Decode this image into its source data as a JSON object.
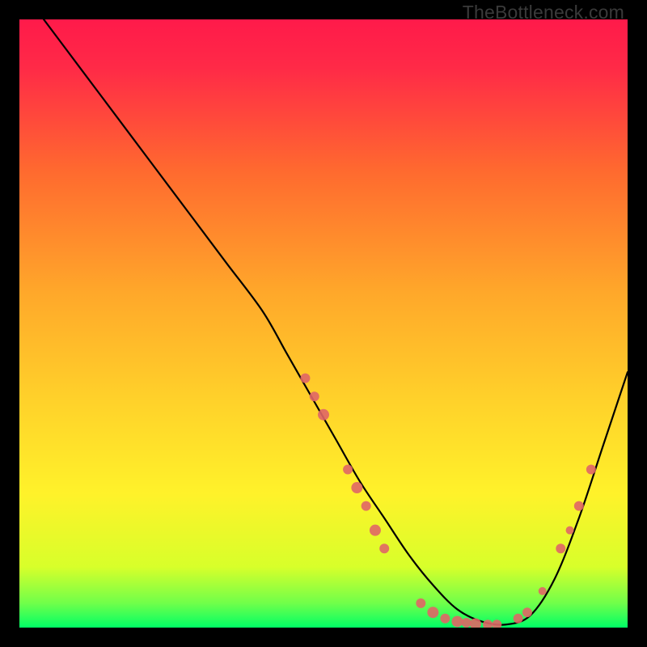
{
  "watermark": "TheBottleneck.com",
  "chart_data": {
    "type": "line",
    "title": "",
    "xlabel": "",
    "ylabel": "",
    "xlim": [
      0,
      100
    ],
    "ylim": [
      0,
      100
    ],
    "gradient_colors": {
      "top": "#ff1a4a",
      "upper_mid": "#ff6a2f",
      "mid": "#ffd02a",
      "lower_mid": "#fff22a",
      "bottom": "#00ff66"
    },
    "series": [
      {
        "name": "bottleneck-curve",
        "x": [
          4,
          10,
          16,
          22,
          28,
          34,
          40,
          44,
          48,
          52,
          56,
          60,
          64,
          68,
          72,
          76,
          80,
          84,
          88,
          92,
          96,
          100
        ],
        "y": [
          100,
          92,
          84,
          76,
          68,
          60,
          52,
          45,
          38,
          31,
          24,
          18,
          12,
          7,
          3,
          1,
          0.5,
          2,
          8,
          18,
          30,
          42
        ]
      }
    ],
    "markers": {
      "name": "highlight-points",
      "color": "#e06666",
      "points": [
        {
          "x": 47,
          "y": 41,
          "r": 6
        },
        {
          "x": 48.5,
          "y": 38,
          "r": 6
        },
        {
          "x": 50,
          "y": 35,
          "r": 7
        },
        {
          "x": 54,
          "y": 26,
          "r": 6
        },
        {
          "x": 55.5,
          "y": 23,
          "r": 7
        },
        {
          "x": 57,
          "y": 20,
          "r": 6
        },
        {
          "x": 58.5,
          "y": 16,
          "r": 7
        },
        {
          "x": 60,
          "y": 13,
          "r": 6
        },
        {
          "x": 66,
          "y": 4,
          "r": 6
        },
        {
          "x": 68,
          "y": 2.5,
          "r": 7
        },
        {
          "x": 70,
          "y": 1.5,
          "r": 6
        },
        {
          "x": 72,
          "y": 1,
          "r": 7
        },
        {
          "x": 73.5,
          "y": 0.8,
          "r": 6
        },
        {
          "x": 75,
          "y": 0.6,
          "r": 7
        },
        {
          "x": 77,
          "y": 0.5,
          "r": 6
        },
        {
          "x": 78.5,
          "y": 0.5,
          "r": 6
        },
        {
          "x": 82,
          "y": 1.5,
          "r": 6
        },
        {
          "x": 83.5,
          "y": 2.5,
          "r": 6
        },
        {
          "x": 86,
          "y": 6,
          "r": 5
        },
        {
          "x": 89,
          "y": 13,
          "r": 6
        },
        {
          "x": 90.5,
          "y": 16,
          "r": 5
        },
        {
          "x": 92,
          "y": 20,
          "r": 6
        },
        {
          "x": 94,
          "y": 26,
          "r": 6
        }
      ]
    }
  }
}
